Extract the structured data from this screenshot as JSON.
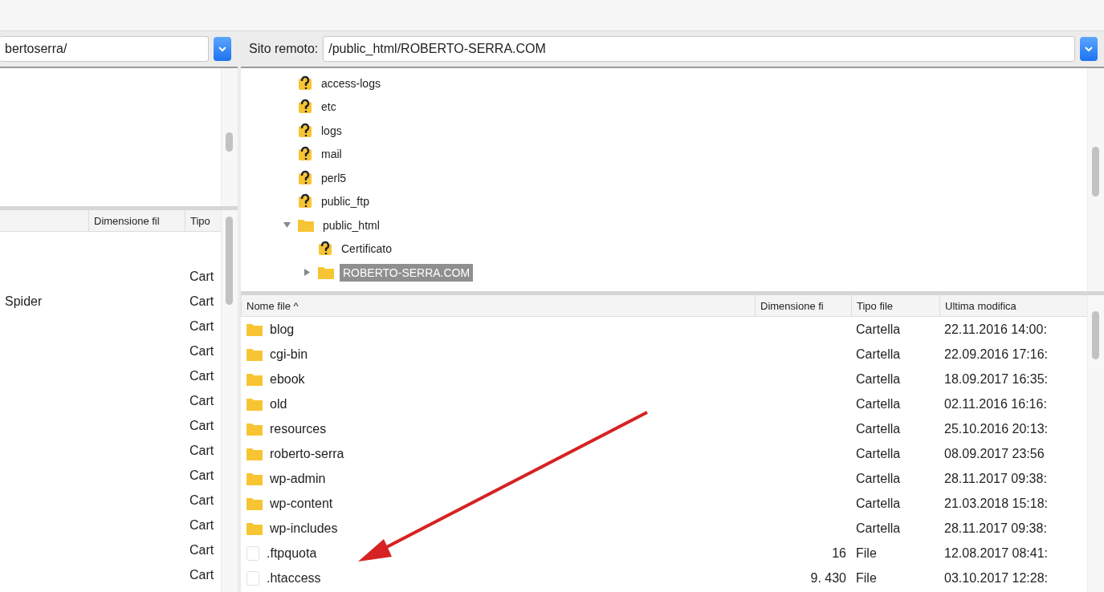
{
  "local": {
    "path": "bertoserra/",
    "list": {
      "columns": [
        "Dimensione fil",
        "Tipo"
      ],
      "rows": [
        {
          "name": "",
          "type": "Cart"
        },
        {
          "name": "Spider",
          "type": "Cart"
        },
        {
          "name": "",
          "type": "Cart"
        },
        {
          "name": "",
          "type": "Cart"
        },
        {
          "name": "",
          "type": "Cart"
        },
        {
          "name": "",
          "type": "Cart"
        },
        {
          "name": "",
          "type": "Cart"
        },
        {
          "name": "",
          "type": "Cart"
        },
        {
          "name": "",
          "type": "Cart"
        },
        {
          "name": "",
          "type": "Cart"
        },
        {
          "name": "",
          "type": "Cart"
        },
        {
          "name": "",
          "type": "Cart"
        },
        {
          "name": "",
          "type": "Cart"
        }
      ]
    }
  },
  "remote": {
    "label": "Sito remoto:",
    "path": "/public_html/ROBERTO-SERRA.COM",
    "tree": [
      {
        "name": "access-logs",
        "kind": "unknown",
        "selected": false
      },
      {
        "name": "etc",
        "kind": "unknown",
        "selected": false
      },
      {
        "name": "logs",
        "kind": "unknown",
        "selected": false
      },
      {
        "name": "mail",
        "kind": "unknown",
        "selected": false
      },
      {
        "name": "perl5",
        "kind": "unknown",
        "selected": false
      },
      {
        "name": "public_ftp",
        "kind": "unknown",
        "selected": false
      },
      {
        "name": "public_html",
        "kind": "folder",
        "selected": false,
        "expanded": true,
        "children": [
          {
            "name": "Certificato",
            "kind": "unknown",
            "selected": false
          },
          {
            "name": "ROBERTO-SERRA.COM",
            "kind": "folder",
            "selected": true,
            "expanded": false
          }
        ]
      }
    ],
    "list": {
      "columns": [
        "Nome file ^",
        "Dimensione fi",
        "Tipo file",
        "Ultima modifica"
      ],
      "rows": [
        {
          "name": "blog",
          "kind": "folder",
          "size": "",
          "type": "Cartella",
          "modified": "22.11.2016 14:00:"
        },
        {
          "name": "cgi-bin",
          "kind": "folder",
          "size": "",
          "type": "Cartella",
          "modified": "22.09.2016 17:16:"
        },
        {
          "name": "ebook",
          "kind": "folder",
          "size": "",
          "type": "Cartella",
          "modified": "18.09.2017 16:35:"
        },
        {
          "name": "old",
          "kind": "folder",
          "size": "",
          "type": "Cartella",
          "modified": "02.11.2016 16:16:"
        },
        {
          "name": "resources",
          "kind": "folder",
          "size": "",
          "type": "Cartella",
          "modified": "25.10.2016 20:13:"
        },
        {
          "name": "roberto-serra",
          "kind": "folder",
          "size": "",
          "type": "Cartella",
          "modified": "08.09.2017 23:56"
        },
        {
          "name": "wp-admin",
          "kind": "folder",
          "size": "",
          "type": "Cartella",
          "modified": "28.11.2017 09:38:"
        },
        {
          "name": "wp-content",
          "kind": "folder",
          "size": "",
          "type": "Cartella",
          "modified": "21.03.2018 15:18:"
        },
        {
          "name": "wp-includes",
          "kind": "folder",
          "size": "",
          "type": "Cartella",
          "modified": "28.11.2017 09:38:"
        },
        {
          "name": ".ftpquota",
          "kind": "file",
          "size": "16",
          "type": "File",
          "modified": "12.08.2017 08:41:"
        },
        {
          "name": ".htaccess",
          "kind": "file",
          "size": "9. 430",
          "type": "File",
          "modified": "03.10.2017 12:28:"
        }
      ]
    }
  }
}
